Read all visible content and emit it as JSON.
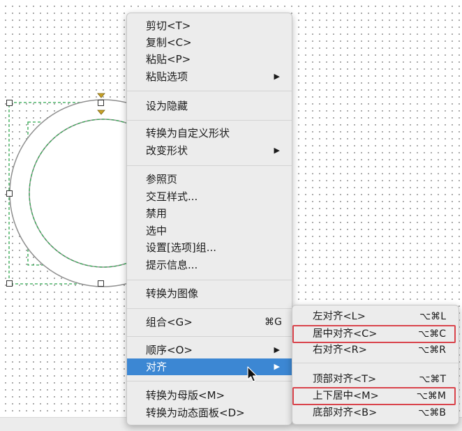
{
  "context_menu": {
    "items": [
      {
        "label": "剪切<T>"
      },
      {
        "label": "复制<C>"
      },
      {
        "label": "粘贴<P>"
      },
      {
        "label": "粘贴选项",
        "arrow": "▶"
      },
      {
        "label": "设为隐藏"
      },
      {
        "label": "转换为自定义形状"
      },
      {
        "label": "改变形状",
        "arrow": "▶"
      },
      {
        "label": "参照页"
      },
      {
        "label": "交互样式..."
      },
      {
        "label": "禁用"
      },
      {
        "label": "选中"
      },
      {
        "label": "设置[选项]组..."
      },
      {
        "label": "提示信息..."
      },
      {
        "label": "转换为图像"
      },
      {
        "label": "组合<G>",
        "shortcut": "⌘G"
      },
      {
        "label": "顺序<O>",
        "arrow": "▶"
      },
      {
        "label": "对齐",
        "arrow": "▶",
        "highlighted": true
      },
      {
        "label": "转换为母版<M>"
      },
      {
        "label": "转换为动态面板<D>"
      }
    ]
  },
  "align_submenu": {
    "items": [
      {
        "label": "左对齐<L>",
        "shortcut": "⌥⌘L"
      },
      {
        "label": "居中对齐<C>",
        "shortcut": "⌥⌘C",
        "boxed": true
      },
      {
        "label": "右对齐<R>",
        "shortcut": "⌥⌘R"
      },
      {
        "label": "顶部对齐<T>",
        "shortcut": "⌥⌘T"
      },
      {
        "label": "上下居中<M>",
        "shortcut": "⌥⌘M",
        "boxed": true
      },
      {
        "label": "底部对齐<B>",
        "shortcut": "⌥⌘B"
      }
    ]
  },
  "colors": {
    "highlight": "#3c87d3",
    "annotation": "#d9434b",
    "selection": "#2fa84f",
    "handle_marker": "#c9a227"
  }
}
